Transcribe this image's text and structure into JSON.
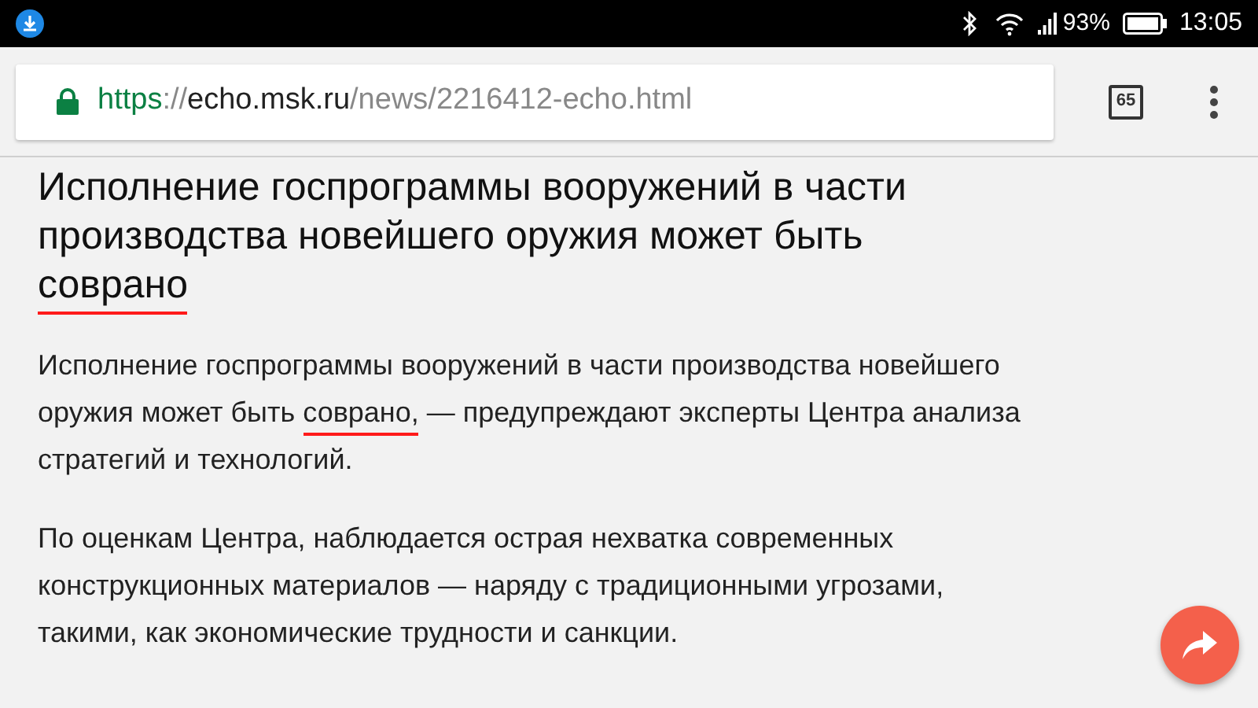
{
  "status_bar": {
    "battery": "93%",
    "time": "13:05"
  },
  "address_bar": {
    "scheme": "https",
    "separator": "://",
    "host": "echo.msk.ru",
    "path": "/news/2216412-echo.html",
    "tab_count": "65"
  },
  "article": {
    "title": [
      {
        "text": "Исполнение госпрограммы вооружений в части производства новейшего оружия может быть ",
        "marked": false
      },
      {
        "text": "соврано",
        "marked": true
      }
    ],
    "paragraphs": [
      [
        {
          "text": "Исполнение госпрограммы вооружений в части производства новейшего оружия может быть ",
          "marked": false
        },
        {
          "text": "соврано,",
          "marked": true
        },
        {
          "text": " — предупреждают эксперты Центра анализа стратегий и технологий.",
          "marked": false
        }
      ],
      [
        {
          "text": "По  оценкам Центра, наблюдается острая нехватка современных конструкционных материалов  — наряду с традиционными угрозами, такими, как экономические трудности и санкции.",
          "marked": false
        }
      ]
    ]
  }
}
